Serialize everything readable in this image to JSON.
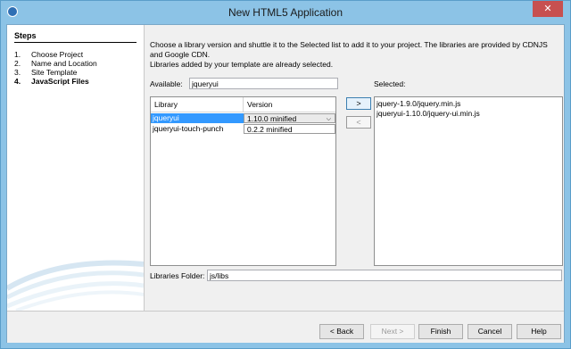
{
  "window": {
    "title": "New HTML5 Application",
    "close_glyph": "✕"
  },
  "steps": {
    "heading": "Steps",
    "items": [
      {
        "num": "1.",
        "label": "Choose Project"
      },
      {
        "num": "2.",
        "label": "Name and Location"
      },
      {
        "num": "3.",
        "label": "Site Template"
      },
      {
        "num": "4.",
        "label": "JavaScript Files"
      }
    ]
  },
  "main": {
    "instruction_line1": "Choose a library version and shuttle it to the Selected list to add it to your project. The libraries are provided by CDNJS",
    "instruction_line2": "and Google CDN.",
    "instruction_line3": "Libraries added by your template are already selected.",
    "available_label": "Available:",
    "available_value": "jqueryui",
    "selected_label": "Selected:",
    "table": {
      "col_library": "Library",
      "col_version": "Version",
      "rows": [
        {
          "library": "jqueryui",
          "version": "1.10.0 minified"
        },
        {
          "library": "jqueryui-touch-punch",
          "version": "0.2.2 minified"
        }
      ]
    },
    "add_button": ">",
    "remove_button": "<",
    "selected_items": [
      "jquery-1.9.0/jquery.min.js",
      "jqueryui-1.10.0/jquery-ui.min.js"
    ],
    "folder_label": "Libraries Folder:",
    "folder_value": "js/libs"
  },
  "footer": {
    "back": "< Back",
    "next": "Next >",
    "finish": "Finish",
    "cancel": "Cancel",
    "help": "Help"
  }
}
